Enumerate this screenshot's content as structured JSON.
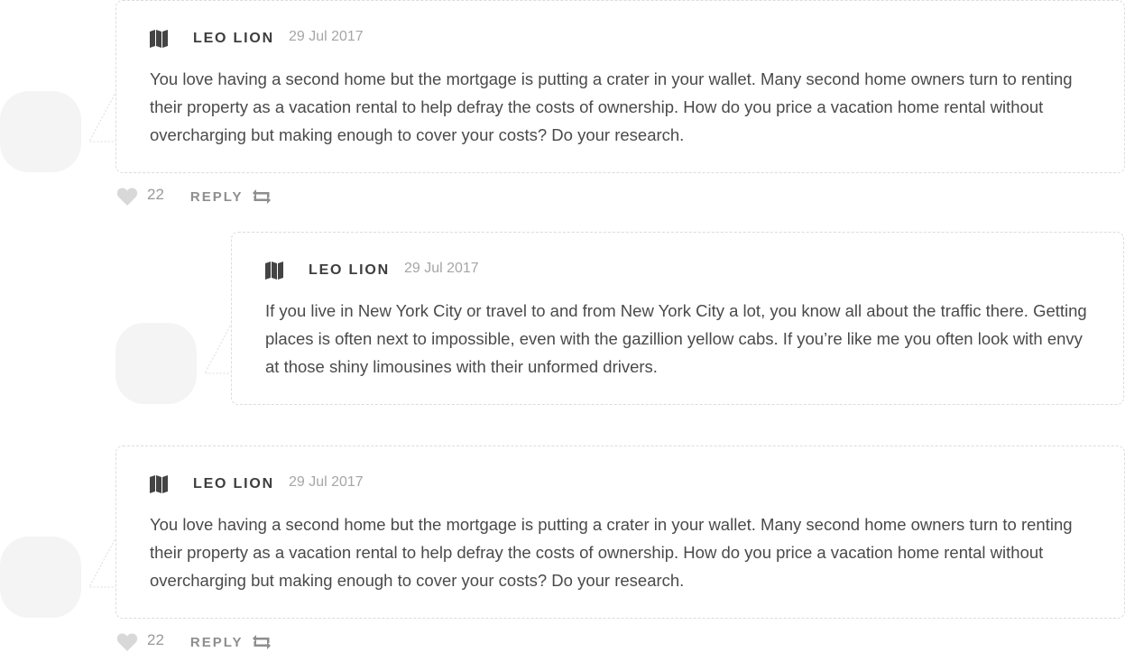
{
  "comments": [
    {
      "author": "Leo Lion",
      "date": "29 Jul 2017",
      "text": "You love having a second home but the mortgage is putting a crater in your wallet. Many second home owners turn to renting their property as a vacation rental to help defray the costs of ownership. How do you price a vacation home rental without overcharging but making enough to cover your costs? Do your research.",
      "likes": "22",
      "reply_label": "Reply"
    },
    {
      "author": "Leo Lion",
      "date": "29 Jul 2017",
      "text": "If you live in New York City or travel to and from New York City a lot, you know all about the traffic there. Getting places is often next to impossible, even with the gazillion yellow cabs. If you’re like me you often look with envy at those shiny limousines with their unformed drivers."
    },
    {
      "author": "Leo Lion",
      "date": "29 Jul 2017",
      "text": "You love having a second home but the mortgage is putting a crater in your wallet. Many second home owners turn to renting their property as a vacation rental to help defray the costs of ownership. How do you price a vacation home rental without overcharging but making enough to cover your costs? Do your research.",
      "likes": "22",
      "reply_label": "Reply"
    }
  ],
  "icons": {
    "author_icon": "map-icon",
    "like_icon": "heart-icon",
    "reply_icon": "reply-arrows-icon"
  },
  "colors": {
    "avatar_placeholder": "#f4f4f4",
    "card_border": "#dcdcdc",
    "author_text": "#3d3d3d",
    "date_text": "#a6a6a6",
    "action_text": "#8e8e8e",
    "icon_dark": "#444444",
    "icon_light": "#d8d8d8"
  }
}
